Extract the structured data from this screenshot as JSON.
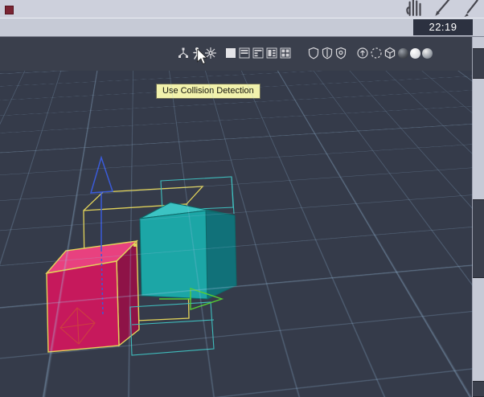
{
  "titlebar": {
    "badge_color": "#7A2433",
    "icons": [
      "hand-icon",
      "brush-icon",
      "pen-icon"
    ]
  },
  "statusbar": {
    "clock": "22:19"
  },
  "viewport_header": {
    "icons": [
      "parent-links-icon",
      "collision-detection-icon",
      "burst-icon",
      "layout-solid-icon",
      "layout-preset-1-icon",
      "layout-preset-2-icon",
      "layout-preset-3-icon",
      "layout-preset-4-icon",
      "shield-plain-icon",
      "shield-line-icon",
      "shield-dot-icon",
      "circle-arrow-icon",
      "dashed-circle-icon",
      "wire-cube-icon",
      "dark-sphere-icon",
      "white-sphere-icon",
      "shaded-sphere-icon"
    ],
    "hovered_icon": "collision-detection-icon"
  },
  "tooltip": {
    "text": "Use Collision Detection",
    "bg": "#F2F2AC"
  },
  "scene": {
    "objects": [
      "magenta-cube",
      "teal-cube",
      "selection-wire-box",
      "ghost-wire-boxes",
      "translate-gizmo",
      "empty-diamond"
    ],
    "colors": {
      "viewport_bg": "#353B4A",
      "grid_line": "#6E8FB0",
      "magenta_front": "#C6195C",
      "magenta_top": "#E8417F",
      "magenta_right": "#8E1347",
      "teal_front": "#1CA6A6",
      "teal_right": "#117179",
      "teal_top": "#3CC3C3",
      "selection_wire": "#E3D45A",
      "ghost_wire": "#3FBDBD",
      "gizmo_z": "#3A5BD8",
      "gizmo_x": "#55CC33",
      "empty_wire": "#CC4040"
    }
  }
}
